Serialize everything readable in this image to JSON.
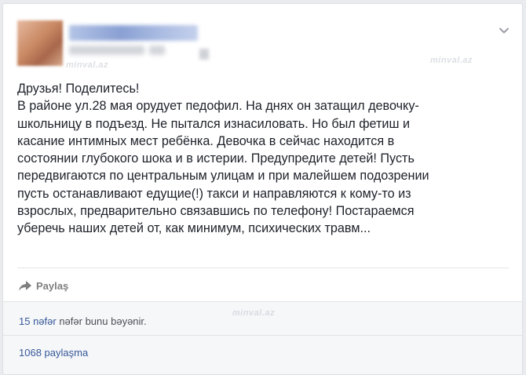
{
  "post": {
    "body_lines": [
      "Друзья! Поделитесь!",
      "В районе ул.28 мая орудует педофил. На днях он затащил девочку-",
      "школьницу в подъезд. Не пытался изнасиловать. Но был фетиш и",
      "касание интимных мест ребёнка. Девочка в сейчас находится в",
      "состоянии глубокого шока и в истерии. Предупредите детей! Пусть",
      "передвигаются по центральным улицам и при малейшем подозрении",
      "пусть останавливают едущие(!) такси и направляются к кому-то из",
      "взрослых, предварительно связавшись по телефону! Постараемся",
      "уберечь наших детей от, как минимум, психических травм..."
    ]
  },
  "actions": {
    "share_label": "Paylaş",
    "share_icon": "share-arrow-icon"
  },
  "summary": {
    "likes_count": "15 nəfər",
    "likes_text": "nəfər bunu bəyənir.",
    "shares_text": "1068 paylaşma"
  },
  "watermark": "minval.az",
  "colors": {
    "link": "#365899",
    "muted": "#7f7f7f",
    "card_bg": "#ffffff",
    "page_bg": "#e9ebee",
    "summary_bg": "#f6f7f9"
  }
}
